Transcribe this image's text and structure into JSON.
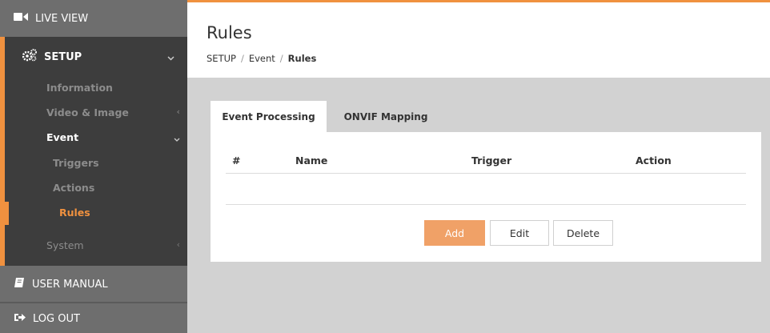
{
  "sidebar": {
    "live_view": "LIVE VIEW",
    "setup": "SETUP",
    "items": [
      {
        "label": "Information"
      },
      {
        "label": "Video & Image"
      },
      {
        "label": "Event"
      },
      {
        "label": "Triggers"
      },
      {
        "label": "Actions"
      },
      {
        "label": "Rules"
      },
      {
        "label": "System"
      }
    ],
    "user_manual": "USER MANUAL",
    "log_out": "LOG OUT"
  },
  "header": {
    "title": "Rules",
    "breadcrumb": [
      "SETUP",
      "Event",
      "Rules"
    ]
  },
  "tabs": [
    {
      "label": "Event Processing",
      "active": true
    },
    {
      "label": "ONVIF Mapping",
      "active": false
    }
  ],
  "table": {
    "columns": [
      "#",
      "Name",
      "Trigger",
      "Action"
    ]
  },
  "buttons": {
    "add": "Add",
    "edit": "Edit",
    "delete": "Delete"
  },
  "colors": {
    "accent": "#f0913f",
    "sidebar": "#6e6e6e",
    "sidebar_dark": "#3d3d3d",
    "background": "#d2d2d2"
  }
}
